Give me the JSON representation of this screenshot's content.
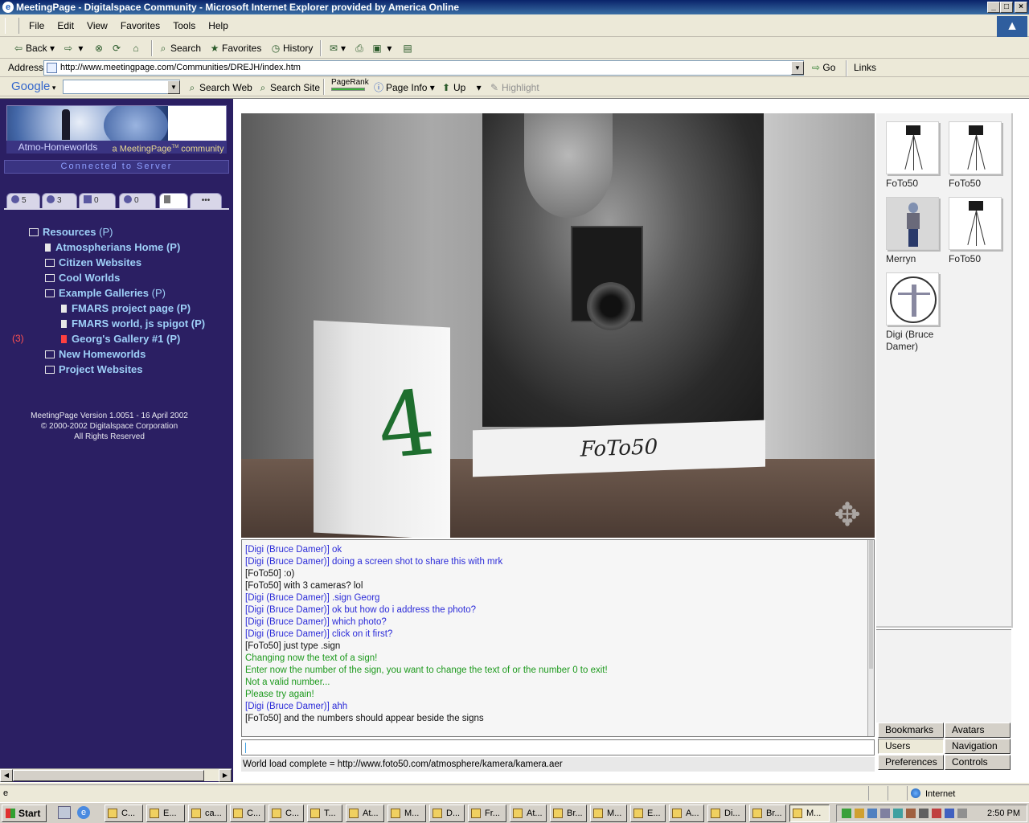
{
  "window": {
    "title": "MeetingPage - Digitalspace Community - Microsoft Internet Explorer provided by America Online",
    "icon": "ie-icon",
    "controls": [
      "_",
      "□",
      "×"
    ]
  },
  "menu": [
    "File",
    "Edit",
    "View",
    "Favorites",
    "Tools",
    "Help"
  ],
  "toolbar": {
    "back": "Back",
    "search": "Search",
    "favorites": "Favorites",
    "history": "History"
  },
  "address": {
    "label": "Address",
    "url": "http://www.meetingpage.com/Communities/DREJH/index.htm",
    "go": "Go",
    "links": "Links"
  },
  "google": {
    "logo": "Google",
    "search_web": "Search Web",
    "search_site": "Search Site",
    "pagerank": "PageRank",
    "page_info": "Page Info",
    "up": "Up",
    "highlight": "Highlight"
  },
  "left": {
    "community_name": "Atmo-Homeworlds",
    "community_tag_pre": "a MeetingPage",
    "community_tag_tm": "TM",
    "community_tag_post": " community",
    "connection_status": "Connected to Server",
    "tabs": [
      {
        "label": "5",
        "icon": "globe-icon"
      },
      {
        "label": "3",
        "icon": "users-icon"
      },
      {
        "label": "0",
        "icon": "mail-icon"
      },
      {
        "label": "0",
        "icon": "network-icon"
      },
      {
        "label": "",
        "icon": "page-icon"
      },
      {
        "label": "•••",
        "icon": "more-icon"
      }
    ],
    "tree": [
      {
        "label": "Resources",
        "suffix": "(P)",
        "icon": "folder-open-icon",
        "indent": 0
      },
      {
        "label": "Atmospherians Home (P)",
        "suffix": "",
        "icon": "document-icon",
        "indent": 1
      },
      {
        "label": "Citizen Websites",
        "suffix": "",
        "icon": "folder-icon",
        "indent": 1
      },
      {
        "label": "Cool Worlds",
        "suffix": "",
        "icon": "folder-icon",
        "indent": 1
      },
      {
        "label": "Example Galleries",
        "suffix": "(P)",
        "icon": "folder-open-icon",
        "indent": 1
      },
      {
        "label": "FMARS project page (P)",
        "suffix": "",
        "icon": "document-icon",
        "indent": 2
      },
      {
        "label": "FMARS world, js spigot (P)",
        "suffix": "",
        "icon": "document-icon",
        "indent": 2
      },
      {
        "label": "Georg's Gallery #1 (P)",
        "suffix": "",
        "icon": "document-red-icon",
        "indent": 2,
        "highlight": true
      },
      {
        "label": "New Homeworlds",
        "suffix": "",
        "icon": "folder-icon",
        "indent": 1
      },
      {
        "label": "Project Websites",
        "suffix": "",
        "icon": "folder-icon",
        "indent": 1
      }
    ],
    "badge": "(3)",
    "footer": [
      "MeetingPage Version 1.0051 - 16 April 2002",
      "© 2000-2002 Digitalspace Corporation",
      "All Rights Reserved"
    ]
  },
  "scene": {
    "plaque_text": "FoTo50",
    "box_number": "4",
    "nav_icon": "move-arrows-icon"
  },
  "chat": {
    "lines": [
      {
        "text": "[Digi (Bruce Damer)] ok",
        "type": "digi"
      },
      {
        "text": "[Digi (Bruce Damer)] doing a screen shot to share this with mrk",
        "type": "digi"
      },
      {
        "text": "[FoTo50] :o)",
        "type": "foto"
      },
      {
        "text": "[FoTo50] with 3 cameras? lol",
        "type": "foto"
      },
      {
        "text": "[Digi (Bruce Damer)] .sign Georg",
        "type": "digi"
      },
      {
        "text": "[Digi (Bruce Damer)] ok but how do i address the photo?",
        "type": "digi"
      },
      {
        "text": "[Digi (Bruce Damer)] which photo?",
        "type": "digi"
      },
      {
        "text": "[Digi (Bruce Damer)] click on it first?",
        "type": "digi"
      },
      {
        "text": "[FoTo50] just type .sign",
        "type": "foto"
      },
      {
        "text": "Changing now the text of a sign!",
        "type": "sys"
      },
      {
        "text": "Enter now the number of the sign, you want to change the text of or the number 0 to exit!",
        "type": "sys"
      },
      {
        "text": "Not a valid number...",
        "type": "sys"
      },
      {
        "text": "Please try again!",
        "type": "sys"
      },
      {
        "text": "[Digi (Bruce Damer)] ahh",
        "type": "digi"
      },
      {
        "text": "[FoTo50] and the numbers should appear beside the signs",
        "type": "foto"
      }
    ],
    "input_value": "",
    "status": "World load complete = http://www.foto50.com/atmosphere/kamera/kamera.aer"
  },
  "avatars": [
    {
      "name": "FoTo50",
      "kind": "tripod"
    },
    {
      "name": "FoTo50",
      "kind": "tripod"
    },
    {
      "name": "Merryn",
      "kind": "person"
    },
    {
      "name": "FoTo50",
      "kind": "tripod"
    },
    {
      "name": "Digi (Bruce Damer)",
      "kind": "vitruvian"
    }
  ],
  "right_buttons": [
    {
      "label": "Bookmarks",
      "active": false
    },
    {
      "label": "Avatars",
      "active": false
    },
    {
      "label": "Users",
      "active": true
    },
    {
      "label": "Navigation",
      "active": false
    },
    {
      "label": "Preferences",
      "active": false
    },
    {
      "label": "Controls",
      "active": false
    }
  ],
  "ie_status": {
    "zone": "Internet"
  },
  "taskbar": {
    "start": "Start",
    "tasks": [
      "C...",
      "E...",
      "ca...",
      "C...",
      "C...",
      "T...",
      "At...",
      "M...",
      "D...",
      "Fr...",
      "At...",
      "Br...",
      "M...",
      "E...",
      "A...",
      "Di...",
      "Br...",
      "M..."
    ],
    "clock": "2:50 PM"
  },
  "colors": {
    "left_panel": "#2b1f63",
    "tree_link": "#9ed0f8",
    "chat_digi": "#2b2bd8",
    "chat_system": "#1e9a1e",
    "title_bar": "#0a246a"
  }
}
